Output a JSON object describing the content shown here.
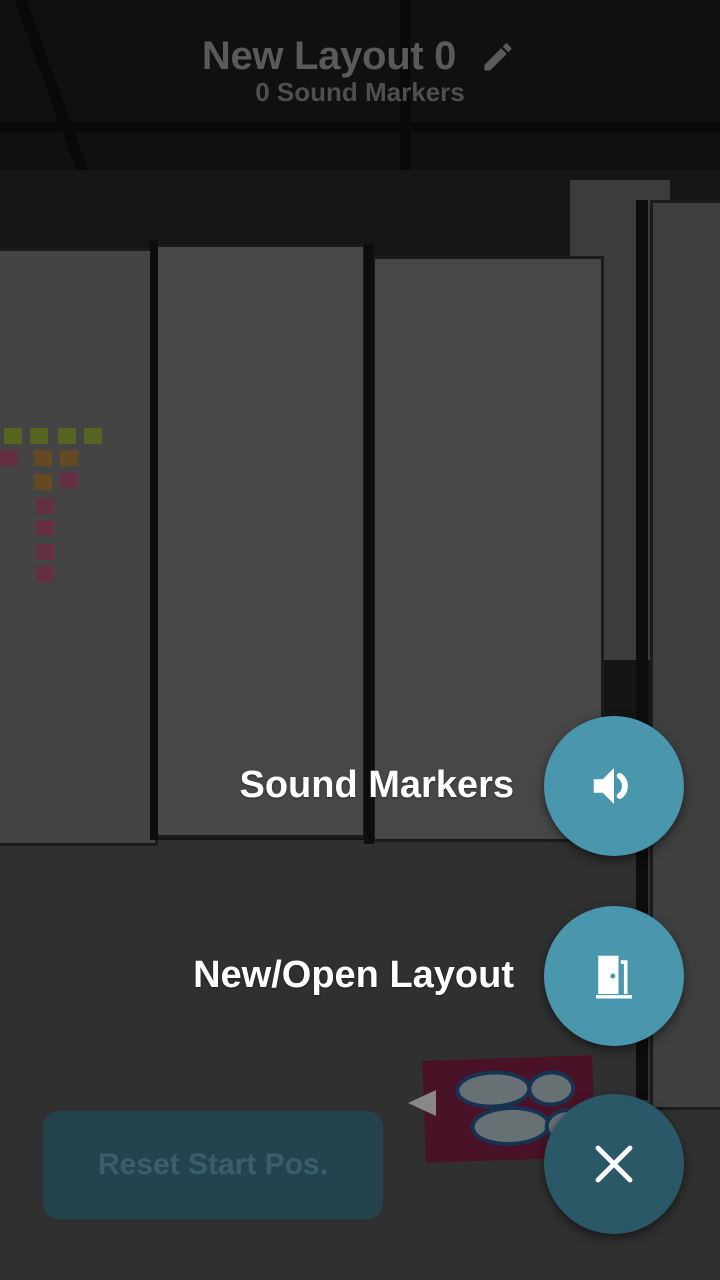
{
  "header": {
    "layout_title": "New Layout 0",
    "marker_count": "0 Sound Markers",
    "edit_icon": "pencil-icon"
  },
  "speed_dial": {
    "sound_markers_label": "Sound Markers",
    "sound_markers_icon": "speaker-icon",
    "new_open_layout_label": "New/Open Layout",
    "new_open_layout_icon": "door-open-icon",
    "close_icon": "close-icon"
  },
  "reset_button_label": "Reset Start Pos.",
  "colors": {
    "fab_accent": "#4a96ad",
    "fab_close": "#2b5866",
    "reset_button_bg": "#24434d"
  }
}
